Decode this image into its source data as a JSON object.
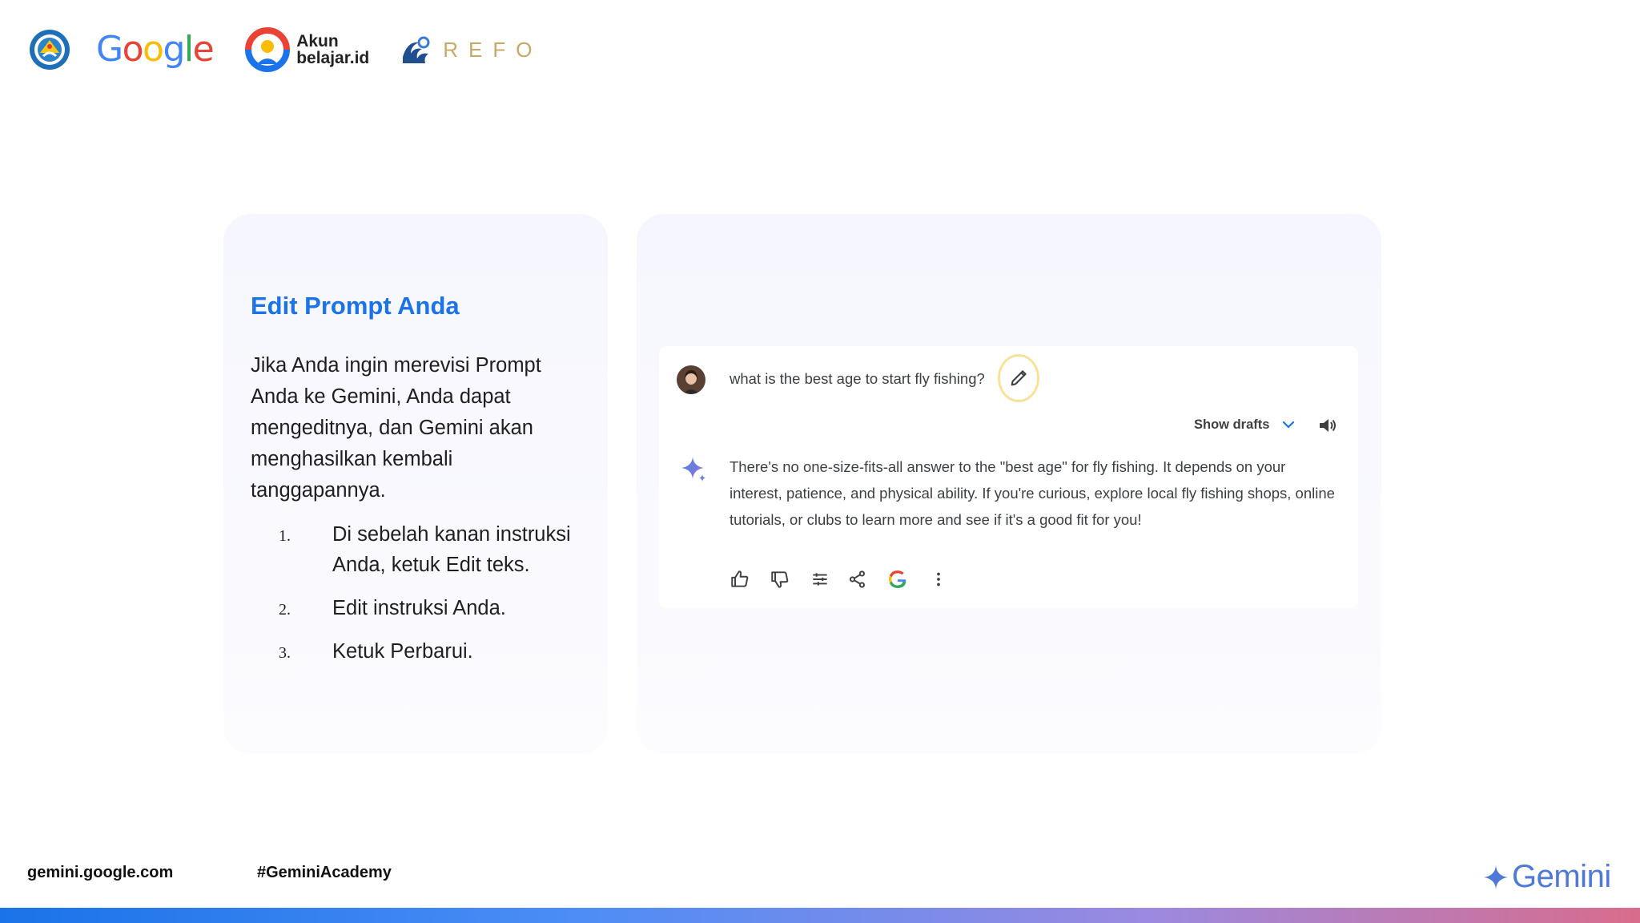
{
  "header": {
    "google_logo_text": "Google",
    "akun_line1": "Akun",
    "akun_line2": "belajar.id",
    "refo_text": "REFO"
  },
  "instructions": {
    "title": "Edit Prompt Anda",
    "body": "Jika Anda ingin merevisi Prompt Anda ke Gemini, Anda dapat mengeditnya, dan Gemini akan menghasilkan kembali tanggapannya.",
    "steps": [
      {
        "num": "1.",
        "text": "Di sebelah kanan instruksi Anda, ketuk Edit teks."
      },
      {
        "num": "2.",
        "text": "Edit instruksi Anda."
      },
      {
        "num": "3.",
        "text": "Ketuk Perbarui."
      }
    ]
  },
  "chat": {
    "prompt": "what is the best age to start fly fishing?",
    "show_drafts_label": "Show drafts",
    "response": "There's no one-size-fits-all answer to the \"best age\" for fly fishing. It depends on your interest, patience, and physical ability. If you're curious, explore local fly fishing shops, online tutorials, or clubs to learn more and see if it's a good fit for you!",
    "action_icons": [
      "thumbs-up-icon",
      "thumbs-down-icon",
      "modify-response-icon",
      "share-icon",
      "google-check-icon",
      "more-options-icon"
    ]
  },
  "footer": {
    "url": "gemini.google.com",
    "hashtag": "#GeminiAcademy",
    "brand": "Gemini"
  },
  "colors": {
    "title_blue": "#1a73e8",
    "gemini_blue": "#4f79d9",
    "refo_gold": "#c9a867",
    "highlight_yellow": "#f6e39b"
  }
}
